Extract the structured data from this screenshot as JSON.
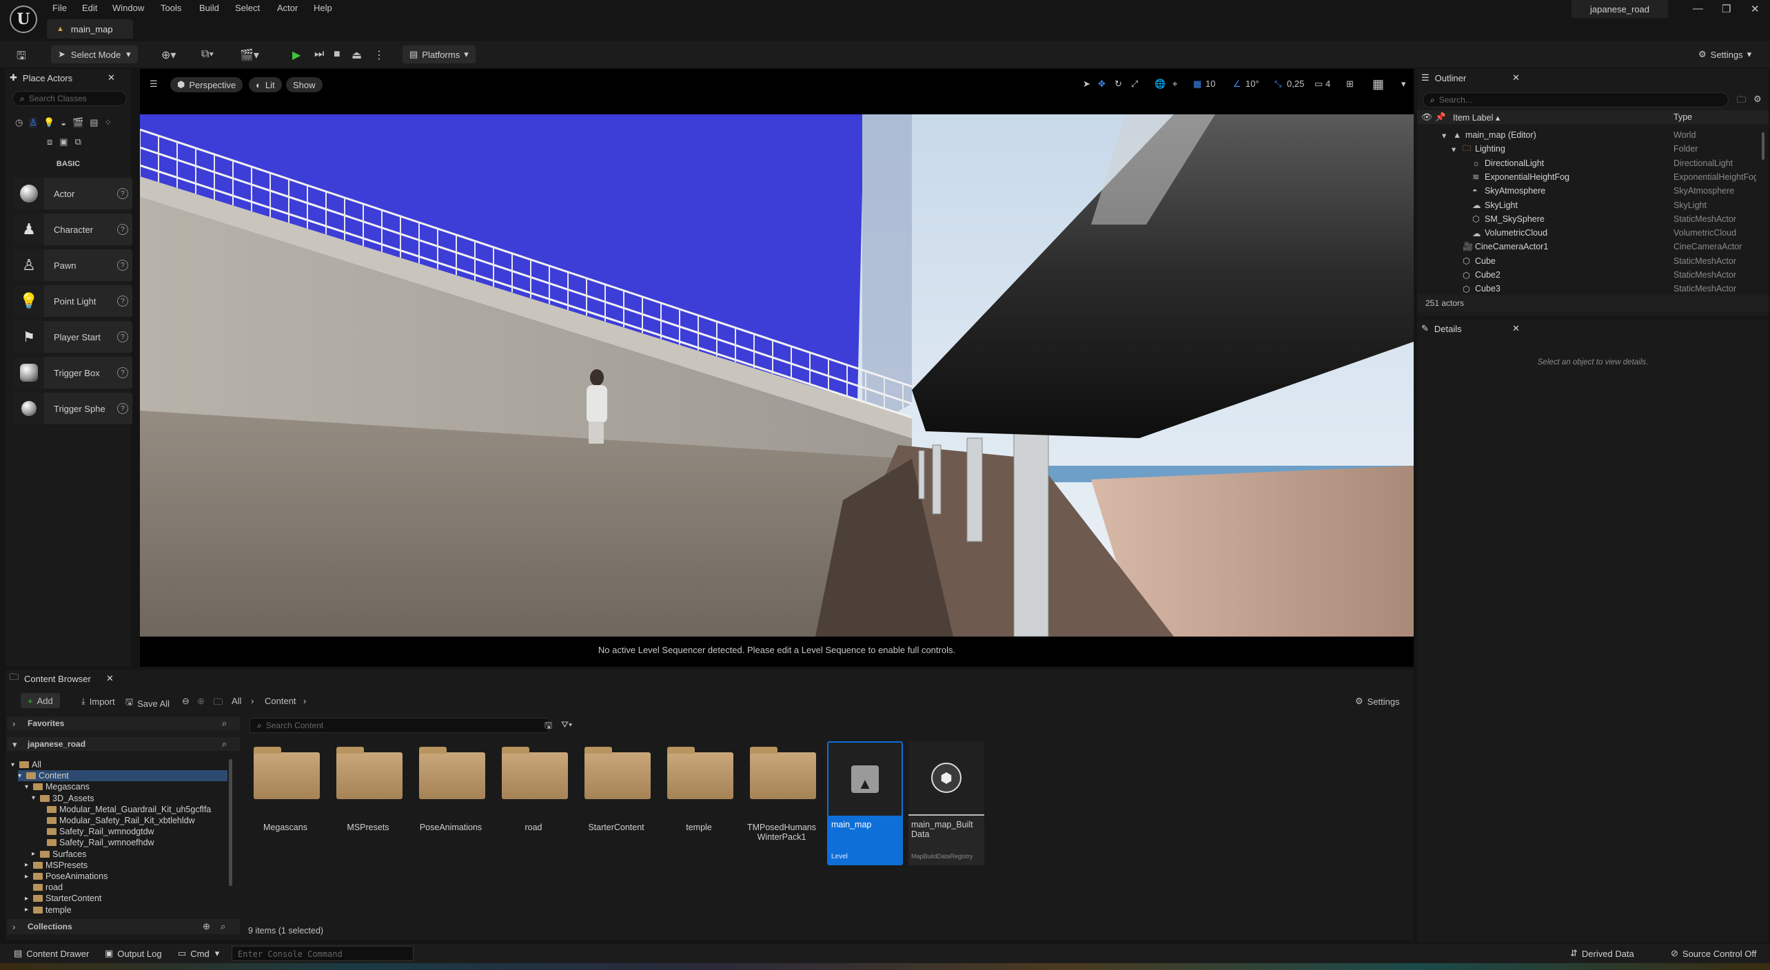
{
  "app": {
    "logo": "U",
    "project_name": "japanese_road",
    "document_tab": "main_map"
  },
  "menu": [
    "File",
    "Edit",
    "Window",
    "Tools",
    "Build",
    "Select",
    "Actor",
    "Help"
  ],
  "toolbar": {
    "select_mode": "Select Mode",
    "platforms": "Platforms",
    "settings": "Settings"
  },
  "place_actors": {
    "tab": "Place Actors",
    "search_placeholder": "Search Classes",
    "category": "BASIC",
    "items": [
      {
        "label": "Actor",
        "icon": "sphere-icon"
      },
      {
        "label": "Character",
        "icon": "character-icon"
      },
      {
        "label": "Pawn",
        "icon": "pawn-icon"
      },
      {
        "label": "Point Light",
        "icon": "point-light-icon"
      },
      {
        "label": "Player Start",
        "icon": "player-start-icon"
      },
      {
        "label": "Trigger Box",
        "icon": "trigger-box-icon"
      },
      {
        "label": "Trigger Sphe",
        "icon": "trigger-sphere-icon"
      }
    ]
  },
  "viewport": {
    "perspective": "Perspective",
    "lit": "Lit",
    "show": "Show",
    "grid_snap": "10",
    "rotation_snap": "10°",
    "scale_snap": "0,25",
    "camera_speed": "4",
    "sequencer_message": "No active Level Sequencer detected. Please edit a Level Sequence to enable full controls."
  },
  "outliner": {
    "tab": "Outliner",
    "search_placeholder": "Search...",
    "col_label": "Item Label ▴",
    "col_type": "Type",
    "rows": [
      {
        "name": "main_map (Editor)",
        "type": "World",
        "indent": 0,
        "icon": "level-icon"
      },
      {
        "name": "Lighting",
        "type": "Folder",
        "indent": 1,
        "icon": "folder-icon"
      },
      {
        "name": "DirectionalLight",
        "type": "DirectionalLight",
        "indent": 2,
        "icon": "sun-icon"
      },
      {
        "name": "ExponentialHeightFog",
        "type": "ExponentialHeightFog",
        "indent": 2,
        "icon": "fog-icon"
      },
      {
        "name": "SkyAtmosphere",
        "type": "SkyAtmosphere",
        "indent": 2,
        "icon": "atmosphere-icon"
      },
      {
        "name": "SkyLight",
        "type": "SkyLight",
        "indent": 2,
        "icon": "skylight-icon"
      },
      {
        "name": "SM_SkySphere",
        "type": "StaticMeshActor",
        "indent": 2,
        "icon": "mesh-icon"
      },
      {
        "name": "VolumetricCloud",
        "type": "VolumetricCloud",
        "indent": 2,
        "icon": "cloud-icon"
      },
      {
        "name": "CineCameraActor1",
        "type": "CineCameraActor",
        "indent": 1,
        "icon": "camera-icon"
      },
      {
        "name": "Cube",
        "type": "StaticMeshActor",
        "indent": 1,
        "icon": "mesh-icon"
      },
      {
        "name": "Cube2",
        "type": "StaticMeshActor",
        "indent": 1,
        "icon": "mesh-icon"
      },
      {
        "name": "Cube3",
        "type": "StaticMeshActor",
        "indent": 1,
        "icon": "mesh-icon"
      }
    ],
    "count": "251 actors"
  },
  "details": {
    "tab": "Details",
    "empty_message": "Select an object to view details."
  },
  "content_browser": {
    "tab": "Content Browser",
    "add": "Add",
    "import": "Import",
    "save_all": "Save All",
    "crumb_all": "All",
    "crumb_content": "Content",
    "settings": "Settings",
    "favorites": "Favorites",
    "project": "japanese_road",
    "search_placeholder": "Search Content",
    "collections": "Collections",
    "status": "9 items (1 selected)",
    "tree": [
      {
        "label": "All",
        "indent": 0,
        "arrow": "▾"
      },
      {
        "label": "Content",
        "indent": 1,
        "arrow": "▾"
      },
      {
        "label": "Megascans",
        "indent": 2,
        "arrow": "▾"
      },
      {
        "label": "3D_Assets",
        "indent": 3,
        "arrow": "▾"
      },
      {
        "label": "Modular_Metal_Guardrail_Kit_uh5gcflfa",
        "indent": 4,
        "arrow": ""
      },
      {
        "label": "Modular_Safety_Rail_Kit_xbtlehldw",
        "indent": 4,
        "arrow": ""
      },
      {
        "label": "Safety_Rail_wmnodgtdw",
        "indent": 4,
        "arrow": ""
      },
      {
        "label": "Safety_Rail_wmnoefhdw",
        "indent": 4,
        "arrow": ""
      },
      {
        "label": "Surfaces",
        "indent": 3,
        "arrow": "▸"
      },
      {
        "label": "MSPresets",
        "indent": 2,
        "arrow": "▸"
      },
      {
        "label": "PoseAnimations",
        "indent": 2,
        "arrow": "▸"
      },
      {
        "label": "road",
        "indent": 2,
        "arrow": ""
      },
      {
        "label": "StarterContent",
        "indent": 2,
        "arrow": "▸"
      },
      {
        "label": "temple",
        "indent": 2,
        "arrow": "▸"
      }
    ],
    "folders": [
      "Megascans",
      "MSPresets",
      "PoseAnimations",
      "road",
      "StarterContent",
      "temple",
      "TMPosedHumans WinterPack1"
    ],
    "assets": [
      {
        "name": "main_map",
        "type": "Level"
      },
      {
        "name": "main_map_Built Data",
        "type": "MapBuildDataRegistry"
      }
    ]
  },
  "statusbar": {
    "content_drawer": "Content Drawer",
    "output_log": "Output Log",
    "cmd": "Cmd",
    "console_placeholder": "Enter Console Command",
    "derived_data": "Derived Data",
    "source_control": "Source Control Off"
  }
}
